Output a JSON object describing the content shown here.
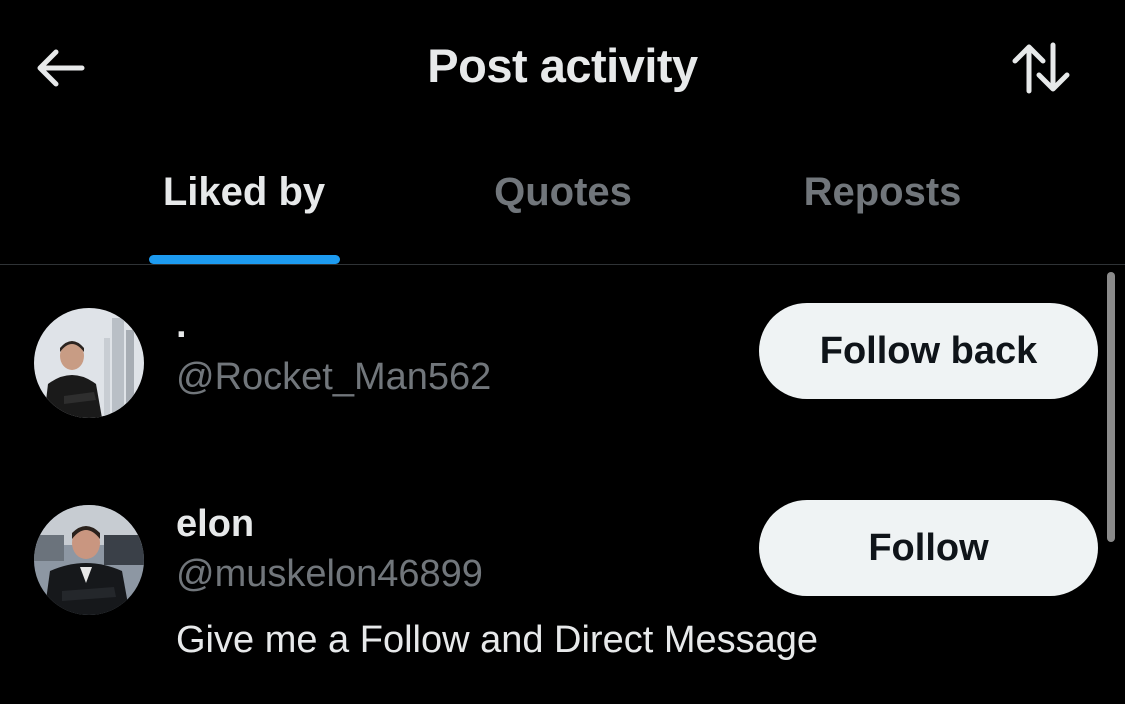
{
  "header": {
    "title": "Post activity",
    "back_icon": "arrow-left-icon",
    "sort_icon": "sort-arrows-icon"
  },
  "tabs": [
    {
      "label": "Liked by",
      "active": true
    },
    {
      "label": "Quotes",
      "active": false
    },
    {
      "label": "Reposts",
      "active": false
    }
  ],
  "users": [
    {
      "display_name": "·",
      "handle": "@Rocket_Man562",
      "button_label": "Follow back",
      "bio": ""
    },
    {
      "display_name": "elon",
      "handle": "@muskelon46899",
      "button_label": "Follow",
      "bio": "Give me a Follow and Direct Message"
    }
  ],
  "colors": {
    "background": "#000000",
    "primary_text": "#e7e9ea",
    "secondary_text": "#71767b",
    "accent": "#1d9bf0",
    "button_bg": "#eff3f4"
  }
}
